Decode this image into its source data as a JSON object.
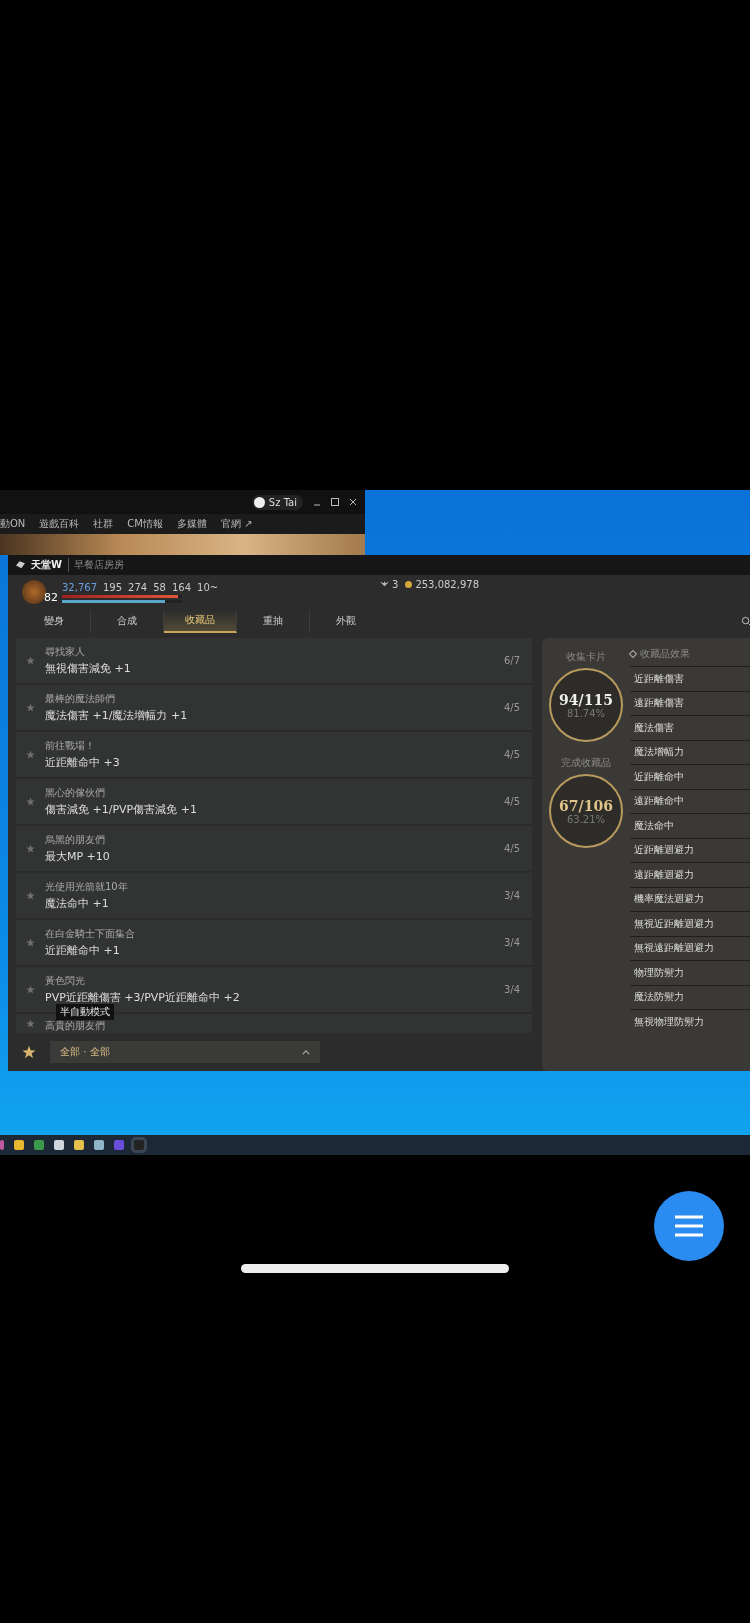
{
  "launcher": {
    "user": "Sz Tai",
    "nav": [
      "動ON",
      "遊戲百科",
      "社群",
      "CM情報",
      "多媒體",
      "官網 ↗"
    ]
  },
  "game": {
    "title": "天堂W",
    "subtitle": "早餐店房房",
    "character": {
      "level": "82",
      "stats": [
        "32,767",
        "195",
        "274",
        "58",
        "164",
        "10~"
      ],
      "hp": {
        "level": 0.97
      },
      "mp": {
        "level": 0.86
      }
    },
    "gems": "3",
    "gold": "253,082,978",
    "tabs": [
      {
        "label": "變身",
        "selected": false
      },
      {
        "label": "合成",
        "selected": false
      },
      {
        "label": "收藏品",
        "selected": true
      },
      {
        "label": "重抽",
        "selected": false
      },
      {
        "label": "外觀",
        "selected": false
      }
    ],
    "collections": [
      {
        "name": "尋找家人",
        "effect": "無視傷害減免 +1",
        "count": "6/7"
      },
      {
        "name": "最棒的魔法師們",
        "effect": "魔法傷害 +1/魔法增幅力 +1",
        "count": "4/5"
      },
      {
        "name": "前往戰場！",
        "effect": "近距離命中 +3",
        "count": "4/5"
      },
      {
        "name": "黑心的傢伙們",
        "effect": "傷害減免 +1/PVP傷害減免 +1",
        "count": "4/5"
      },
      {
        "name": "烏黑的朋友們",
        "effect": "最大MP +10",
        "count": "4/5"
      },
      {
        "name": "光使用光箭就10年",
        "effect": "魔法命中 +1",
        "count": "3/4"
      },
      {
        "name": "在白金騎士下面集合",
        "effect": "近距離命中 +1",
        "count": "3/4"
      },
      {
        "name": "黃色閃光",
        "effect": "PVP近距離傷害 +3/PVP近距離命中 +2",
        "count": "3/4"
      },
      {
        "name": "高貴的朋友們"
      }
    ],
    "tooltip": "半自動模式",
    "filter": "全部 · 全部",
    "summary": [
      {
        "label": "收集卡片",
        "value": "94/115",
        "percent": "81.74%"
      },
      {
        "label": "完成收藏品",
        "value": "67/106",
        "percent": "63.21%"
      }
    ],
    "effects_title": "收藏品效果",
    "effects": [
      "近距離傷害",
      "遠距離傷害",
      "魔法傷害",
      "魔法增幅力",
      "近距離命中",
      "遠距離命中",
      "魔法命中",
      "近距離迴避力",
      "遠距離迴避力",
      "機率魔法迴避力",
      "無視近距離迴避力",
      "無視遠距離迴避力",
      "物理防禦力",
      "魔法防禦力",
      "無視物理防禦力"
    ]
  }
}
